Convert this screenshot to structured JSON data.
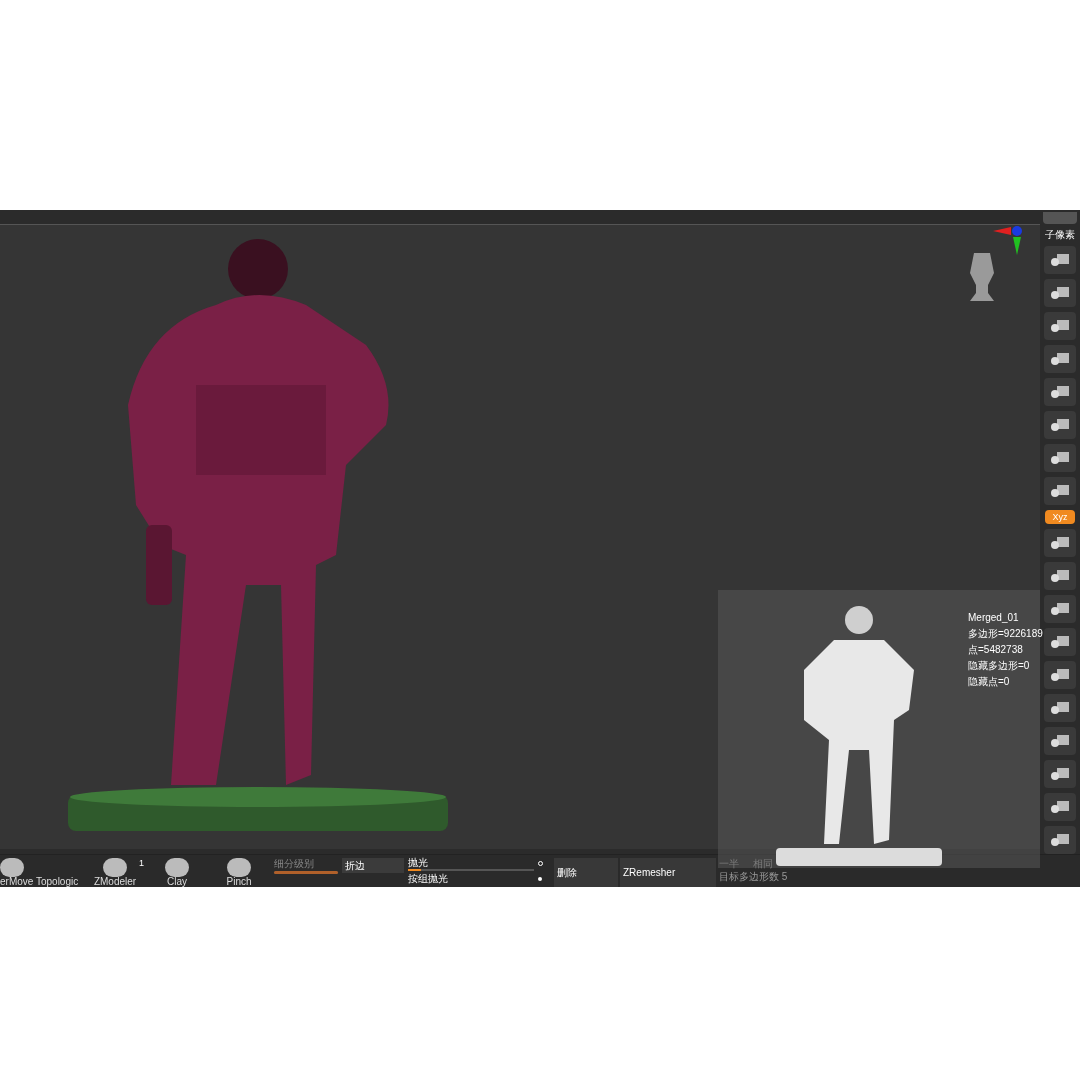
{
  "right_toolbar": {
    "subpixel_label": "子像素",
    "xyz_button": {
      "label": "Xyz",
      "selected": true
    }
  },
  "bottom_bar": {
    "brushes": [
      {
        "label": "erMove Topologic"
      },
      {
        "label": "ZModeler",
        "count": "1"
      },
      {
        "label": "Clay"
      },
      {
        "label": "Pinch"
      }
    ],
    "subdivision": {
      "label": "细分级别",
      "level": 1.0
    },
    "crease_button": "折边",
    "polish": {
      "label": "抛光",
      "level": 0.1
    },
    "group_polish": "按组抛光",
    "delete_button": "删除",
    "zremesher_button": "ZRemesher",
    "half_button": "一半",
    "same_button": "相同",
    "target_polygons": "目标多边形数 5"
  },
  "info": {
    "name": "Merged_01",
    "lines": [
      "多边形=9226189",
      "点=5482738",
      "隐藏多边形=0",
      "隐藏点=0"
    ]
  }
}
